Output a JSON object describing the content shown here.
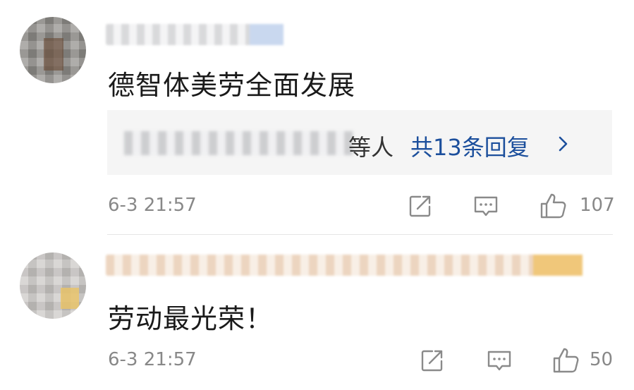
{
  "comments": [
    {
      "content": "德智体美劳全面发展",
      "reply_preview": {
        "suffix": "等人",
        "count_label": "共13条回复"
      },
      "timestamp": "6-3 21:57",
      "likes": "107"
    },
    {
      "content": "劳动最光荣！",
      "timestamp": "6-3 21:57",
      "likes": "50"
    }
  ],
  "icons": {
    "share": "share-icon",
    "comment": "comment-icon",
    "like": "thumbs-up-icon",
    "chevron": "chevron-right-icon"
  },
  "colors": {
    "link_blue": "#1c4f9c",
    "meta_gray": "#888888",
    "reply_bg": "#f5f5f5"
  }
}
